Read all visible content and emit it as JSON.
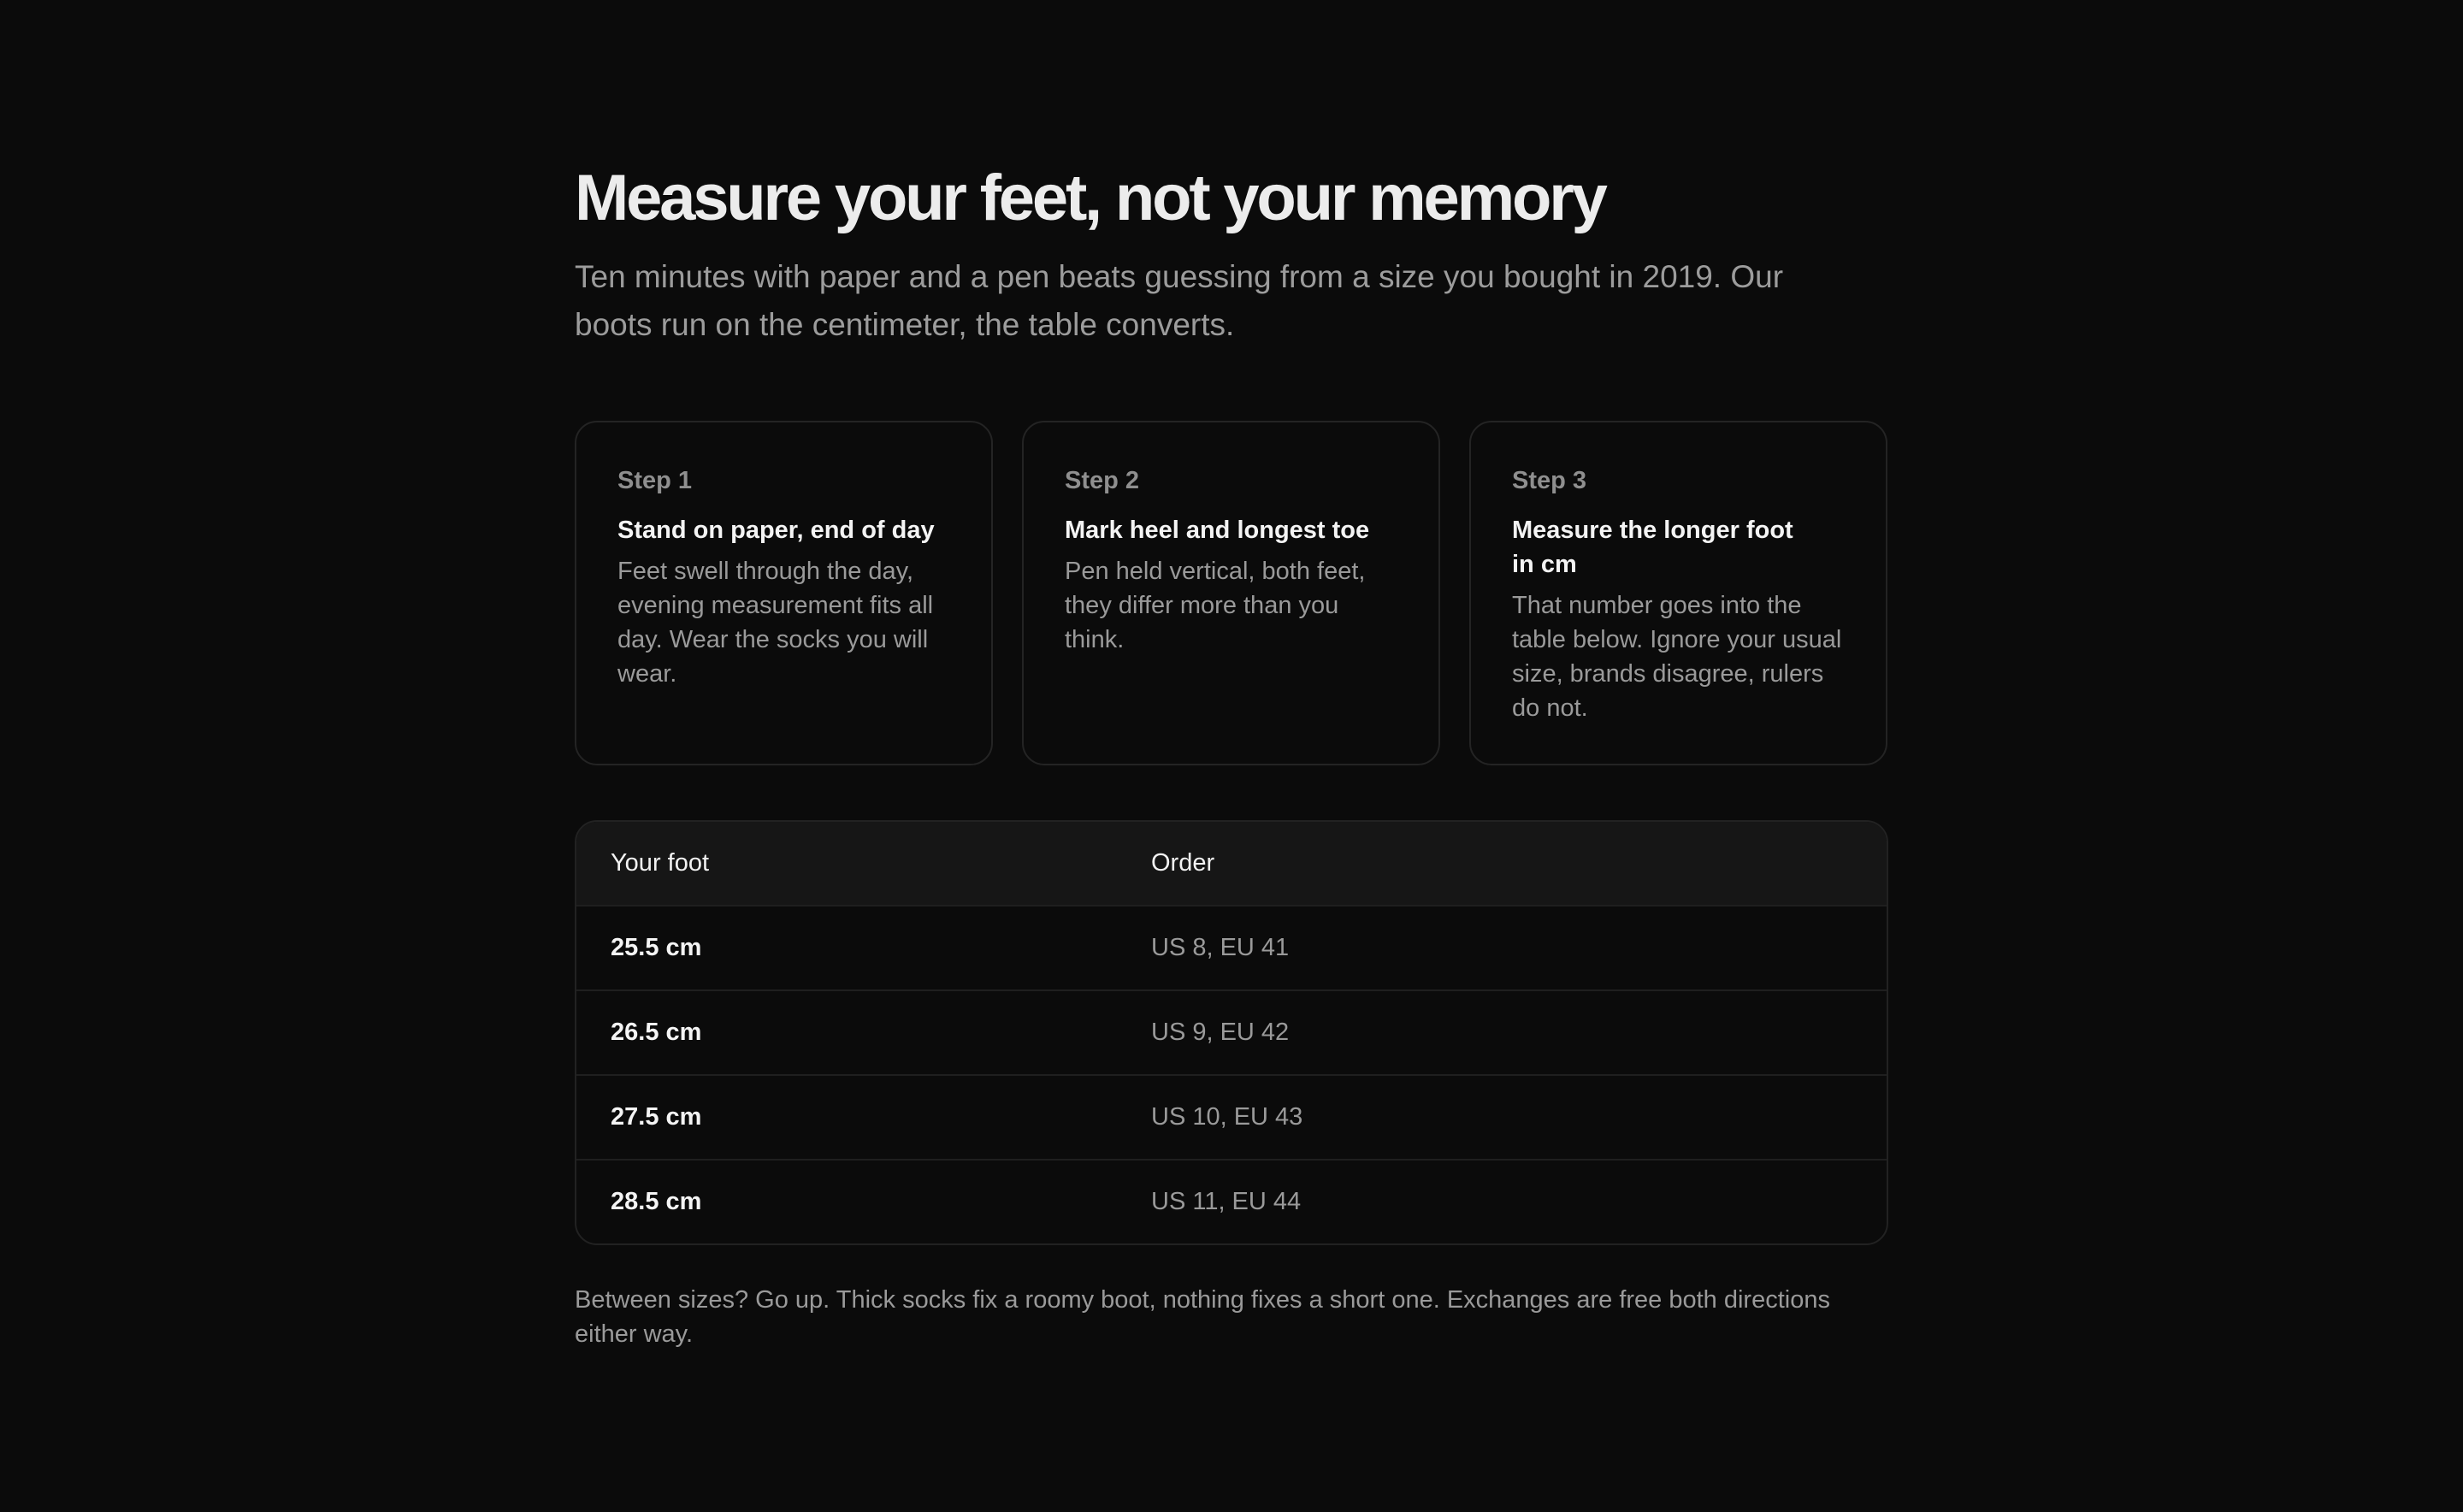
{
  "header": {
    "title": "Measure your feet, not your memory",
    "subtitle": "Ten minutes with paper and a pen beats guessing from a size you bought in 2019. Our boots run on the centimeter, the table converts."
  },
  "steps": [
    {
      "label": "Step 1",
      "title": "Stand on paper, end of day",
      "body": "Feet swell through the day, evening measurement fits all day. Wear the socks you will wear."
    },
    {
      "label": "Step 2",
      "title": "Mark heel and longest toe",
      "body": "Pen held vertical, both feet, they differ more than you think."
    },
    {
      "label": "Step 3",
      "title": "Measure the longer foot in cm",
      "body": "That number goes into the table below. Ignore your usual size, brands disagree, rulers do not."
    }
  ],
  "table": {
    "headers": [
      "Your foot",
      "Order"
    ],
    "rows": [
      {
        "foot": "25.5 cm",
        "order": "US 8, EU 41"
      },
      {
        "foot": "26.5 cm",
        "order": "US 9, EU 42"
      },
      {
        "foot": "27.5 cm",
        "order": "US 10, EU 43"
      },
      {
        "foot": "28.5 cm",
        "order": "US 11, EU 44"
      }
    ]
  },
  "footnote": "Between sizes? Go up. Thick socks fix a roomy boot, nothing fixes a short one. Exchanges are free both directions either way.",
  "colors": {
    "background": "#0b0b0b",
    "text_primary": "#ededed",
    "text_muted": "#9a9a9a",
    "border": "#242424",
    "table_header_bg": "#161616"
  }
}
